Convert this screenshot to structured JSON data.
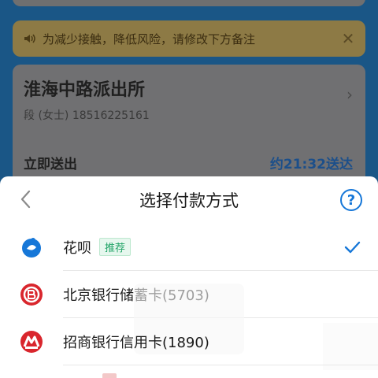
{
  "background": {
    "banner_text": "为减少接触，降低风险，请修改下方备注",
    "card_title": "淮海中路派出所",
    "card_subtitle": "段 (女士) 18516225161",
    "delivery_label": "立即送出",
    "delivery_time": "约21:32送达"
  },
  "sheet": {
    "title": "选择付款方式",
    "help_label": "?",
    "methods": [
      {
        "label": "花呗",
        "tag": "推荐",
        "selected": true
      },
      {
        "label": "北京银行储蓄卡(5703)",
        "tag": "",
        "selected": false
      },
      {
        "label": "招商银行信用卡(1890)",
        "tag": "",
        "selected": false
      }
    ]
  },
  "colors": {
    "accent": "#1677d8",
    "tag_green": "#1fa366",
    "huabei_blue": "#1677d8",
    "bank_red": "#d9262d"
  }
}
